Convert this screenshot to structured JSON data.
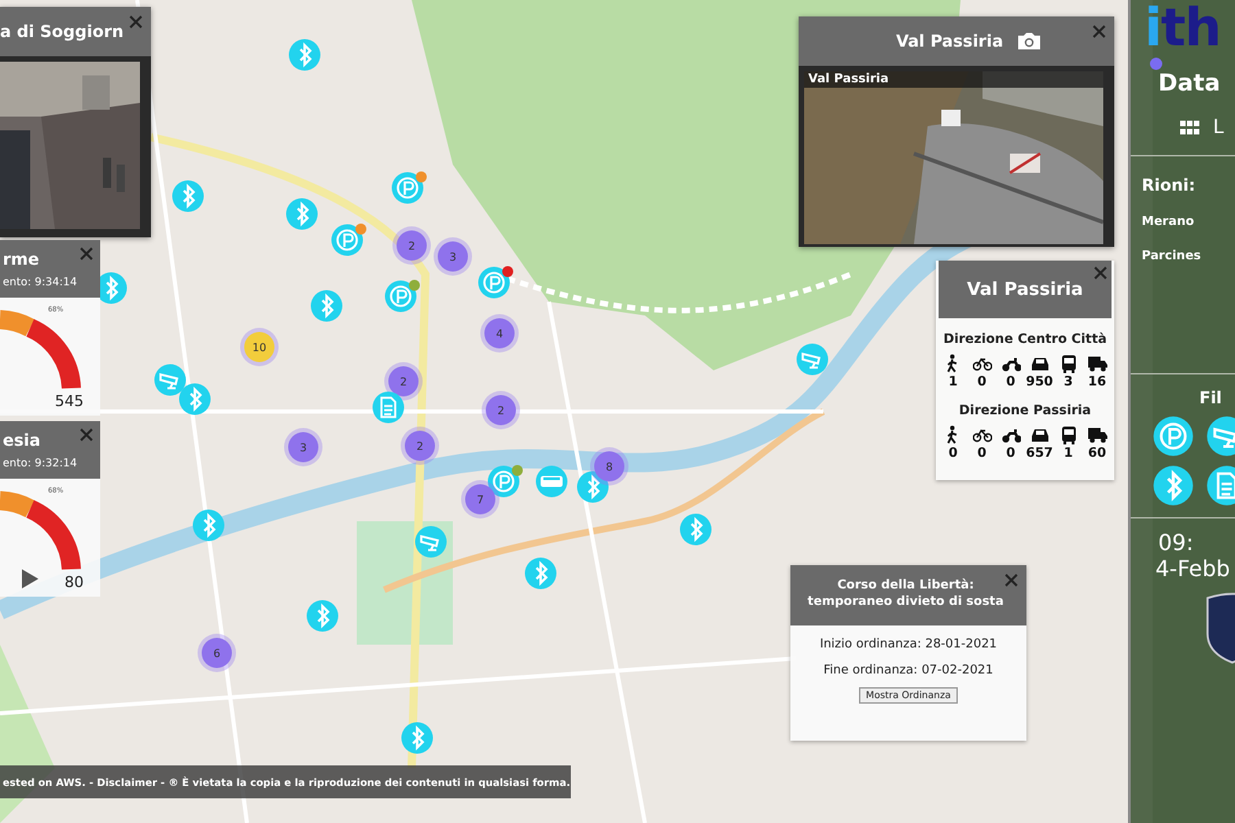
{
  "camera_popups": [
    {
      "title": "a di Soggiorn"
    },
    {
      "title": "Val Passiria",
      "caption": "Val Passiria"
    }
  ],
  "gauge_panels": [
    {
      "title": "rme",
      "updated": "ento: 9:34:14",
      "tick_label": "68%",
      "value": "545",
      "playing": false
    },
    {
      "title": "esia",
      "updated": "ento: 9:32:14",
      "tick_label": "68%",
      "value": "80",
      "playing": true
    }
  ],
  "traffic_panel": {
    "title": "Val Passiria",
    "directions": [
      {
        "name": "Direzione Centro Città",
        "counts": [
          "1",
          "0",
          "0",
          "950",
          "3",
          "16"
        ]
      },
      {
        "name": "Direzione Passiria",
        "counts": [
          "0",
          "0",
          "0",
          "657",
          "1",
          "60"
        ]
      }
    ]
  },
  "notice": {
    "title": "Corso della Libertà: temporaneo divieto di sosta",
    "start": "Inizio ordinanza: 28-01-2021",
    "end": "Fine ordinanza: 07-02-2021",
    "button": "Mostra Ordinanza"
  },
  "sidebar": {
    "logo": "ith",
    "title": "Data",
    "menu_label": "L",
    "districts_label": "Rioni:",
    "districts": [
      "Merano",
      "Parcines"
    ],
    "filters_label": "Fil",
    "filters": [
      {
        "kind": "parking"
      },
      {
        "kind": "camera"
      },
      {
        "kind": "bluetooth"
      },
      {
        "kind": "document"
      }
    ],
    "time": "09:",
    "date": "4-Febb"
  },
  "footer": "ested on AWS. - Disclaimer - ® È vietata la copia e la riproduzione dei contenuti in qualsiasi forma.",
  "map_markers": [
    {
      "kind": "bluetooth"
    },
    {
      "kind": "bluetooth"
    },
    {
      "kind": "bluetooth"
    },
    {
      "kind": "parking",
      "color": "#f0902c"
    },
    {
      "kind": "parking",
      "color": "#f0902c"
    },
    {
      "kind": "cluster",
      "count": "2",
      "color": "#8f72ec"
    },
    {
      "kind": "cluster",
      "count": "3",
      "color": "#8f72ec"
    },
    {
      "kind": "parking",
      "color": "#e02020"
    },
    {
      "kind": "parking",
      "color": "#8fae3c"
    },
    {
      "kind": "bluetooth"
    },
    {
      "kind": "cluster",
      "count": "4",
      "color": "#8f72ec"
    },
    {
      "kind": "cluster",
      "count": "10",
      "color": "#f2cd3c"
    },
    {
      "kind": "camera"
    },
    {
      "kind": "bluetooth"
    },
    {
      "kind": "cluster",
      "count": "2",
      "color": "#8f72ec"
    },
    {
      "kind": "document"
    },
    {
      "kind": "cluster",
      "count": "2",
      "color": "#8f72ec"
    },
    {
      "kind": "cluster",
      "count": "3",
      "color": "#8f72ec"
    },
    {
      "kind": "cluster",
      "count": "2",
      "color": "#8f72ec"
    },
    {
      "kind": "parking",
      "color": "#8fae3c"
    },
    {
      "kind": "bus"
    },
    {
      "kind": "bluetooth"
    },
    {
      "kind": "cluster",
      "count": "7",
      "color": "#8f72ec"
    },
    {
      "kind": "cluster",
      "count": "8",
      "color": "#8f72ec"
    },
    {
      "kind": "bluetooth"
    },
    {
      "kind": "camera"
    },
    {
      "kind": "bluetooth"
    },
    {
      "kind": "bluetooth"
    },
    {
      "kind": "bluetooth"
    },
    {
      "kind": "cluster",
      "count": "6",
      "color": "#8f72ec"
    },
    {
      "kind": "bluetooth"
    },
    {
      "kind": "camera"
    },
    {
      "kind": "bluetooth"
    }
  ]
}
